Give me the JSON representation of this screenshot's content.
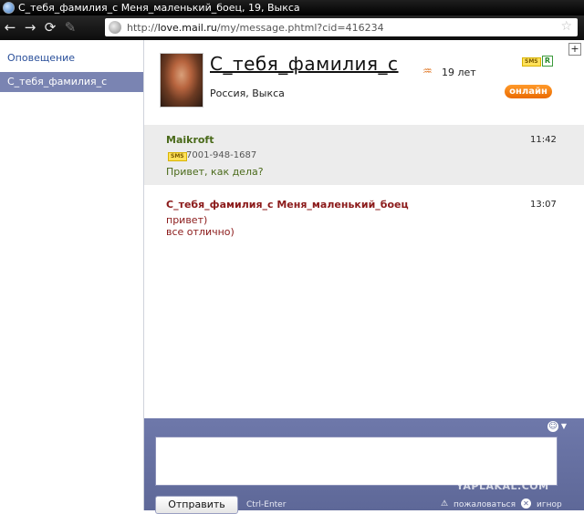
{
  "window": {
    "title": "С_тебя_фамилия_с Меня_маленький_боец, 19, Выкса"
  },
  "toolbar": {
    "back_glyph": "←",
    "forward_glyph": "→",
    "reload_glyph": "⟳",
    "edit_glyph": "✎",
    "url_prefix": "http://",
    "url_host": "love.mail.ru",
    "url_path": "/my/message.phtml?cid=416234",
    "bookmark_glyph": "☆"
  },
  "sidebar": {
    "notifications_label": "Оповещение",
    "contacts": [
      {
        "label": "С_тебя_фамилия_с"
      }
    ]
  },
  "profile": {
    "name": "С_тебя_фамилия_с",
    "location": "Россия, Выкса",
    "zodiac_glyph": "♒",
    "age": "19 лет",
    "sms_badge": "SMS",
    "r_badge": "R",
    "status": "онлайн"
  },
  "messages": [
    {
      "author": "Maikroft",
      "time": "11:42",
      "sms_badge": "SMS",
      "phone": "7001-948-1687",
      "lines": [
        "Привет, как дела?"
      ]
    },
    {
      "author": "С_тебя_фамилия_с Меня_маленький_боец",
      "time": "13:07",
      "lines": [
        "привет)",
        "все отлично)"
      ]
    }
  ],
  "compose": {
    "smiley_glyph": "☺",
    "caret_glyph": "▼",
    "send_label": "Отправить",
    "hint": "Ctrl-Enter",
    "complain_glyph": "⚠",
    "complain_label": "пожаловаться",
    "ignore_glyph": "✕",
    "ignore_label": "игнор"
  },
  "watermark": "YAPLAKAL.COM",
  "colors": {
    "accent_orange": "#ea6a00",
    "author_green": "#4a6a1a",
    "author_red": "#8b1a1a",
    "panel_blue": "#6e78aa"
  }
}
